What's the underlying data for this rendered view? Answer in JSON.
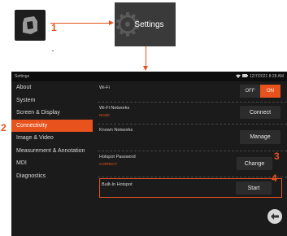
{
  "callouts": [
    "1",
    "2",
    "3",
    "4"
  ],
  "settings_tile": {
    "label": "Settings",
    "icon": "gear-icon"
  },
  "app_icon": "app-logo-icon",
  "statusbar": {
    "title": "Settings",
    "icons": [
      "wifi-icon",
      "battery-icon"
    ],
    "datetime": "12/7/2021  8:28 AM"
  },
  "sidebar": {
    "items": [
      {
        "label": "About"
      },
      {
        "label": "System"
      },
      {
        "label": "Screen & Display"
      },
      {
        "label": "Connectivity"
      },
      {
        "label": "Image & Video"
      },
      {
        "label": "Measurement & Annotation"
      },
      {
        "label": "MDI"
      },
      {
        "label": "Diagnostics"
      }
    ],
    "active_index": 3
  },
  "settings": {
    "wifi": {
      "title": "Wi-Fi",
      "off_label": "OFF",
      "on_label": "ON",
      "state": "ON"
    },
    "networks": {
      "title": "Wi-Fi Networks",
      "status": "NONE",
      "button": "Connect"
    },
    "known": {
      "title": "Known Networks",
      "button": "Manage"
    },
    "hotspot_password": {
      "title": "Hotspot Password",
      "value": "CORRECT",
      "button": "Change"
    },
    "builtin_hotspot": {
      "title": "Built-In Hotspot",
      "button": "Start"
    }
  },
  "colors": {
    "accent": "#e8521d",
    "screen_bg": "#1b1b1b",
    "button_bg": "#2c2c2c"
  },
  "back_icon": "back-arrow-icon"
}
